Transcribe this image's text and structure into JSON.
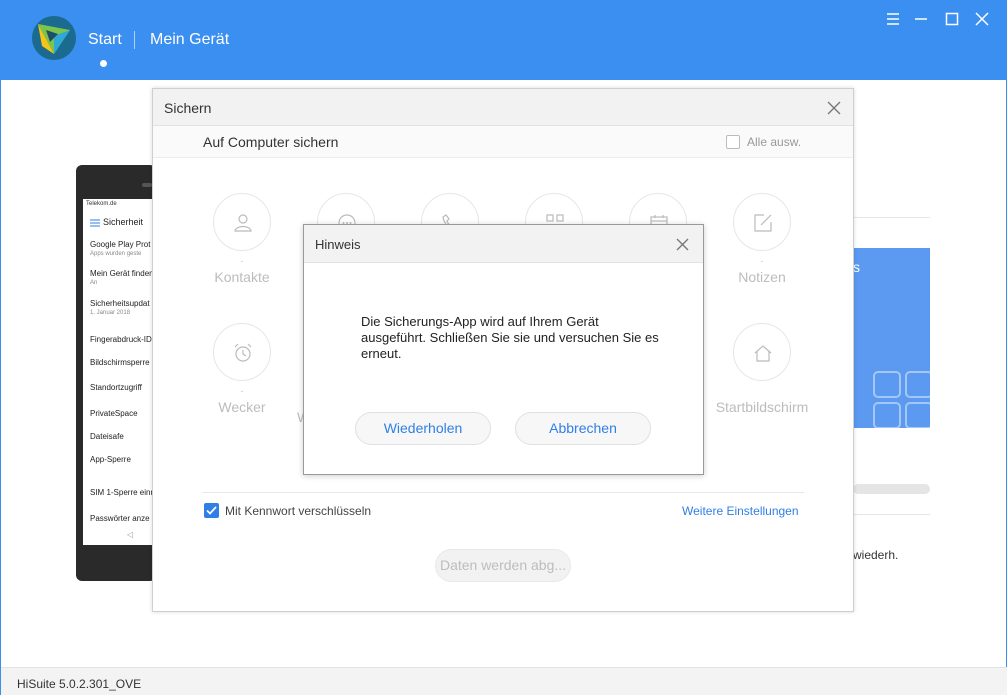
{
  "header": {
    "nav_start": "Start",
    "nav_device": "Mein Gerät",
    "window_controls": [
      "menu-icon",
      "minimize-icon",
      "maximize-icon",
      "close-icon"
    ]
  },
  "phone": {
    "carrier": "Telekom.de",
    "screen_title": "Sicherheit",
    "items": [
      {
        "label": "Google Play Prot",
        "sub": "Apps wurden geste"
      },
      {
        "label": "Mein Gerät finden",
        "sub": "An"
      },
      {
        "label": "Sicherheitsupdat",
        "sub": "1. Januar 2018"
      },
      {
        "label": "Fingerabdruck-ID",
        "sub": ""
      },
      {
        "label": "Bildschirmsperre",
        "sub": ""
      },
      {
        "label": "Standortzugriff",
        "sub": ""
      },
      {
        "label": "PrivateSpace",
        "sub": ""
      },
      {
        "label": "Dateisafe",
        "sub": ""
      },
      {
        "label": "App-Sperre",
        "sub": ""
      },
      {
        "label": "SIM 1-Sperre einr",
        "sub": ""
      },
      {
        "label": "Passwörter anze",
        "sub": ""
      }
    ]
  },
  "background": {
    "blue_card_text": "s",
    "restore_text": "wiederh."
  },
  "backup_dialog": {
    "title": "Sichern",
    "subtitle": "Auf Computer sichern",
    "select_all_label": "Alle ausw.",
    "categories": [
      {
        "label": "Kontakte",
        "icon": "person-icon",
        "dash": "-"
      },
      {
        "label": "Notizen",
        "icon": "note-edit-icon",
        "dash": "-"
      },
      {
        "label": "Wecker",
        "icon": "alarm-clock-icon",
        "dash": "-"
      },
      {
        "label": "Startbildschirm",
        "icon": "home-icon",
        "dash": "-"
      }
    ],
    "partial_label": "W",
    "encrypt_label": "Mit Kennwort verschlüsseln",
    "more_settings_label": "Weitere Einstellungen",
    "backup_button_label": "Daten werden abg..."
  },
  "hint_modal": {
    "title": "Hinweis",
    "message": "Die Sicherungs-App wird auf Ihrem Gerät ausgeführt. Schließen Sie sie und versuchen Sie es erneut.",
    "retry_label": "Wiederholen",
    "cancel_label": "Abbrechen"
  },
  "footer": {
    "version": "HiSuite 5.0.2.301_OVE"
  },
  "colors": {
    "header_blue": "#3b8ff1",
    "accent_blue": "#2f7fe6"
  }
}
